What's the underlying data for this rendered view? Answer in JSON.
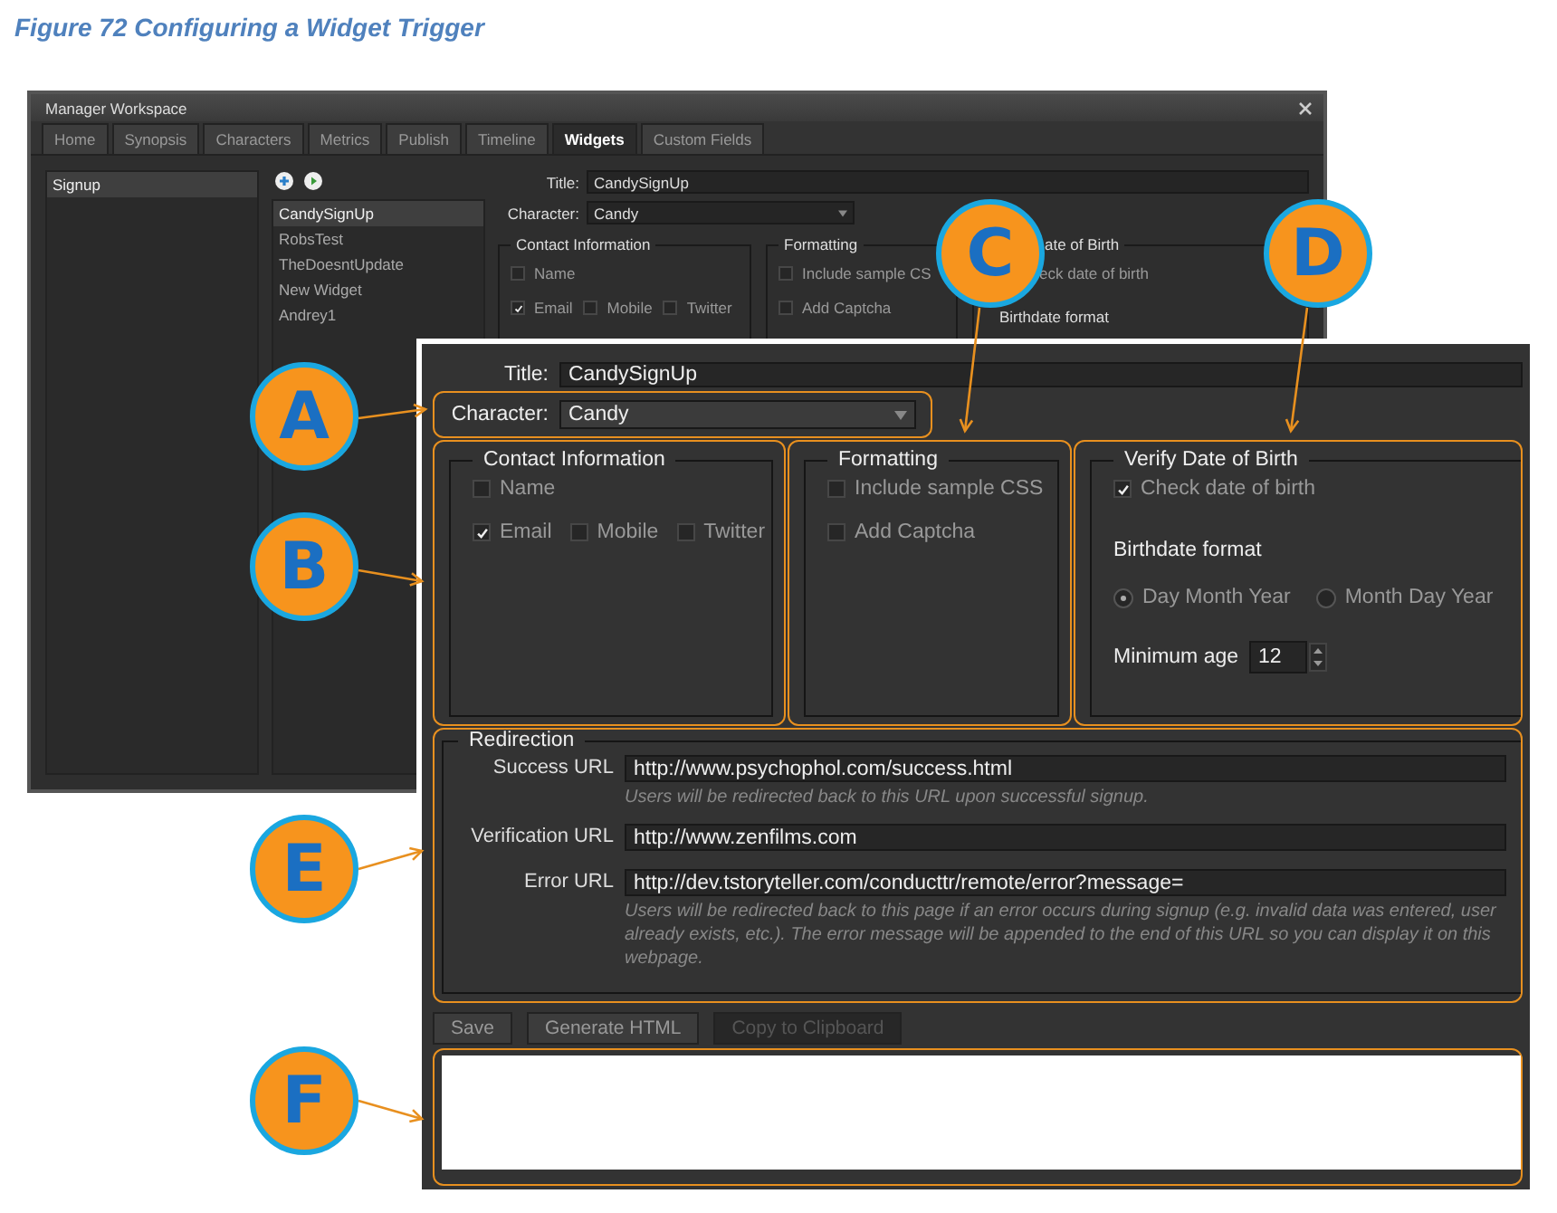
{
  "caption": "Figure 72 Configuring a Widget Trigger",
  "back_window": {
    "title": "Manager Workspace",
    "tabs": [
      {
        "label": "Home",
        "selected": false
      },
      {
        "label": "Synopsis",
        "selected": false
      },
      {
        "label": "Characters",
        "selected": false
      },
      {
        "label": "Metrics",
        "selected": false
      },
      {
        "label": "Publish",
        "selected": false
      },
      {
        "label": "Timeline",
        "selected": false
      },
      {
        "label": "Widgets",
        "selected": true
      },
      {
        "label": "Custom Fields",
        "selected": false
      }
    ],
    "categories": [
      {
        "label": "Signup",
        "selected": true
      }
    ],
    "widgets": [
      {
        "label": "CandySignUp",
        "selected": true
      },
      {
        "label": "RobsTest",
        "selected": false
      },
      {
        "label": "TheDoesntUpdate",
        "selected": false
      },
      {
        "label": "New Widget",
        "selected": false
      },
      {
        "label": "Andrey1",
        "selected": false
      }
    ],
    "title_label": "Title:",
    "title_value": "CandySignUp",
    "character_label": "Character:",
    "character_value": "Candy",
    "contact": {
      "legend": "Contact Information",
      "options": [
        {
          "label": "Name",
          "checked": false
        },
        {
          "label": "Email",
          "checked": true
        },
        {
          "label": "Mobile",
          "checked": false
        },
        {
          "label": "Twitter",
          "checked": false
        }
      ]
    },
    "formatting": {
      "legend": "Formatting",
      "options": [
        {
          "label": "Include sample CS",
          "checked": false
        },
        {
          "label": "Add Captcha",
          "checked": false
        }
      ]
    },
    "dob": {
      "legend": "ate of Birth",
      "check_label": "eck date of birth",
      "format_label": "Birthdate format"
    }
  },
  "detail": {
    "title_label": "Title:",
    "title_value": "CandySignUp",
    "character_label": "Character:",
    "character_value": "Candy",
    "contact": {
      "legend": "Contact Information",
      "options": [
        {
          "label": "Name",
          "checked": false
        },
        {
          "label": "Email",
          "checked": true
        },
        {
          "label": "Mobile",
          "checked": false
        },
        {
          "label": "Twitter",
          "checked": false
        }
      ]
    },
    "formatting": {
      "legend": "Formatting",
      "options": [
        {
          "label": "Include sample CSS",
          "checked": false
        },
        {
          "label": "Add Captcha",
          "checked": false
        }
      ]
    },
    "dob": {
      "legend": "Verify Date of Birth",
      "check": {
        "label": "Check date of birth",
        "checked": true
      },
      "format_label": "Birthdate format",
      "formats": [
        {
          "label": "Day Month Year",
          "selected": true
        },
        {
          "label": "Month Day Year",
          "selected": false
        }
      ],
      "min_age_label": "Minimum age",
      "min_age": "12"
    },
    "redirection": {
      "legend": "Redirection",
      "fields": [
        {
          "label": "Success URL",
          "value": "http://www.psychophol.com/success.html",
          "hint": "Users will be redirected back to this URL upon successful signup."
        },
        {
          "label": "Verification URL",
          "value": "http://www.zenfilms.com"
        },
        {
          "label": "Error URL",
          "value": "http://dev.tstoryteller.com/conducttr/remote/error?message=",
          "hint": "Users will be redirected back to this page if an error occurs during signup (e.g. invalid data was entered, user already exists, etc.). The error message will be appended to the end of this URL so you can display it on this webpage."
        }
      ]
    },
    "buttons": [
      {
        "label": "Save",
        "disabled": false
      },
      {
        "label": "Generate HTML",
        "disabled": false
      },
      {
        "label": "Copy to Clipboard",
        "disabled": true
      }
    ]
  },
  "callouts": [
    {
      "letter": "A"
    },
    {
      "letter": "B"
    },
    {
      "letter": "C"
    },
    {
      "letter": "D"
    },
    {
      "letter": "E"
    },
    {
      "letter": "F"
    }
  ]
}
